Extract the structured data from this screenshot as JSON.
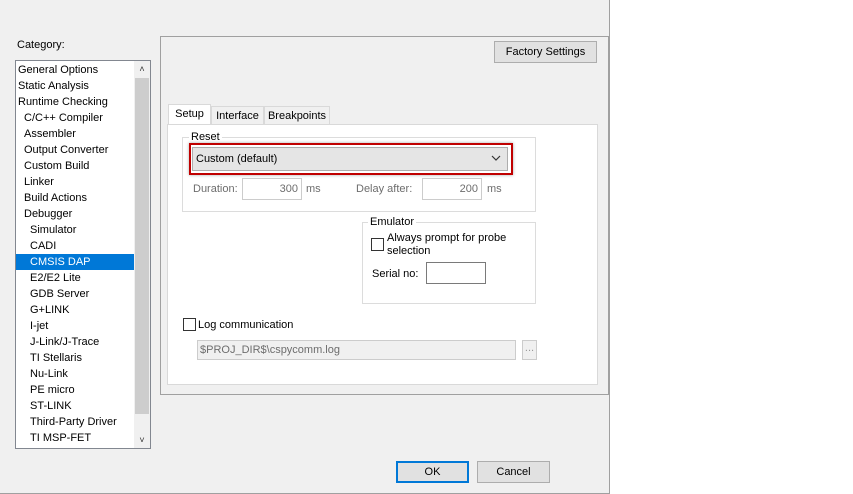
{
  "category": {
    "label": "Category:",
    "items": [
      {
        "label": "General Options",
        "indent": 0
      },
      {
        "label": "Static Analysis",
        "indent": 0
      },
      {
        "label": "Runtime Checking",
        "indent": 0
      },
      {
        "label": "C/C++ Compiler",
        "indent": 1
      },
      {
        "label": "Assembler",
        "indent": 1
      },
      {
        "label": "Output Converter",
        "indent": 1
      },
      {
        "label": "Custom Build",
        "indent": 1
      },
      {
        "label": "Linker",
        "indent": 1
      },
      {
        "label": "Build Actions",
        "indent": 1
      },
      {
        "label": "Debugger",
        "indent": 1
      },
      {
        "label": "Simulator",
        "indent": 2
      },
      {
        "label": "CADI",
        "indent": 2
      },
      {
        "label": "CMSIS DAP",
        "indent": 2
      },
      {
        "label": "E2/E2 Lite",
        "indent": 2
      },
      {
        "label": "GDB Server",
        "indent": 2
      },
      {
        "label": "G+LINK",
        "indent": 2
      },
      {
        "label": "I-jet",
        "indent": 2
      },
      {
        "label": "J-Link/J-Trace",
        "indent": 2
      },
      {
        "label": "TI Stellaris",
        "indent": 2
      },
      {
        "label": "Nu-Link",
        "indent": 2
      },
      {
        "label": "PE micro",
        "indent": 2
      },
      {
        "label": "ST-LINK",
        "indent": 2
      },
      {
        "label": "Third-Party Driver",
        "indent": 2
      },
      {
        "label": "TI MSP-FET",
        "indent": 2
      }
    ],
    "selected_index": 12,
    "scroll_up_icon": "chevron-up-icon",
    "scroll_down_icon": "chevron-down-icon"
  },
  "factory_settings_label": "Factory Settings",
  "tabs": [
    {
      "label": "Setup",
      "active": true
    },
    {
      "label": "Interface",
      "active": false
    },
    {
      "label": "Breakpoints",
      "active": false
    }
  ],
  "reset": {
    "group_title": "Reset",
    "selected": "Custom (default)",
    "dropdown_icon": "chevron-down-icon",
    "duration_label": "Duration:",
    "duration_value": "300",
    "duration_unit": "ms",
    "delay_label": "Delay after:",
    "delay_value": "200",
    "delay_unit": "ms"
  },
  "emulator": {
    "group_title": "Emulator",
    "always_prompt_line1": "Always prompt for probe",
    "always_prompt_line2": "selection",
    "always_prompt_checked": false,
    "serial_label": "Serial no:",
    "serial_value": ""
  },
  "log": {
    "label": "Log communication",
    "checked": false,
    "path": "$PROJ_DIR$\\cspycomm.log",
    "browse_label": "..."
  },
  "footer": {
    "ok_label": "OK",
    "cancel_label": "Cancel"
  },
  "colors": {
    "selection": "#0078d7",
    "highlight_border": "#c00000",
    "dialog_bg": "#f0f0f0"
  }
}
